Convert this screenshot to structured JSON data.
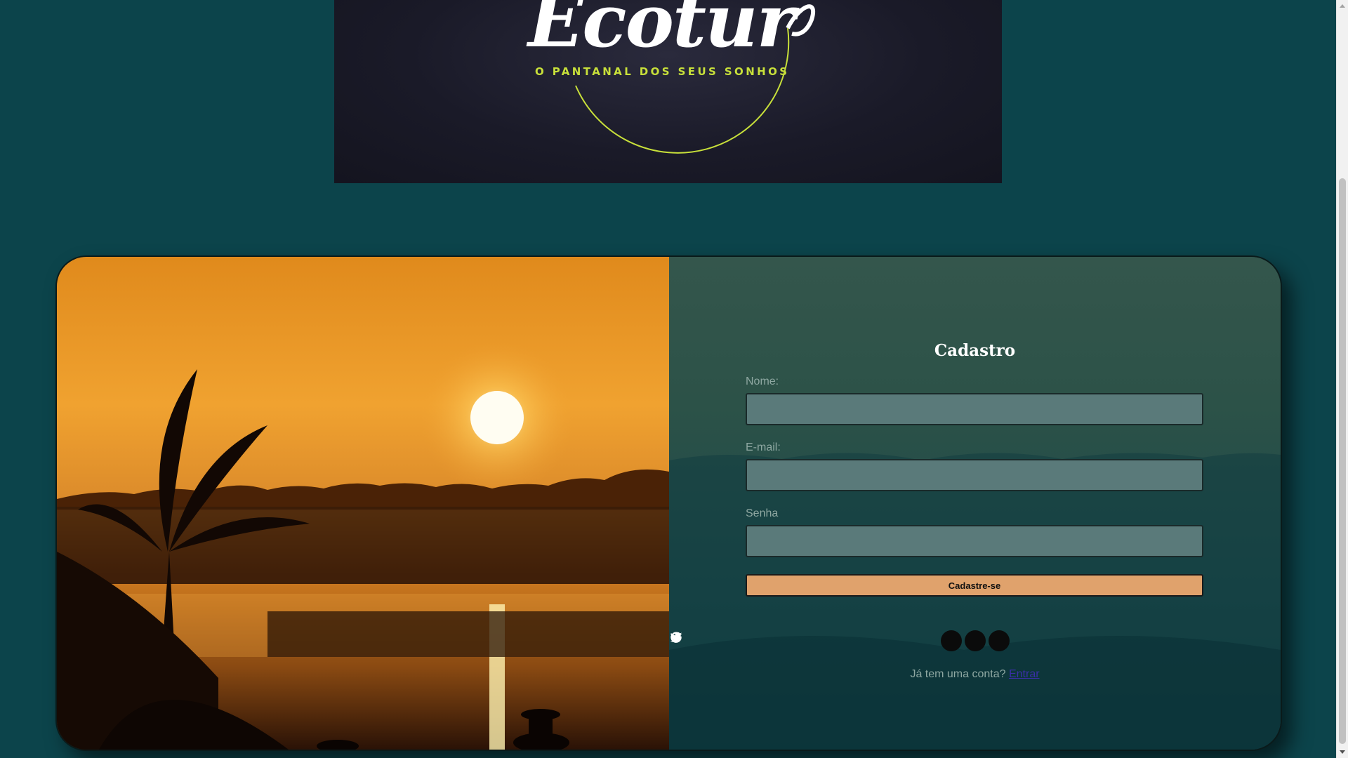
{
  "banner": {
    "brand_name": "Ecotur",
    "tagline": "O PANTANAL DOS SEUS SONHOS"
  },
  "form": {
    "title": "Cadastro",
    "fields": [
      {
        "label": "Nome:",
        "value": ""
      },
      {
        "label": "E-mail:",
        "value": ""
      },
      {
        "label": "Senha",
        "value": ""
      }
    ],
    "submit_label": "Cadastre-se",
    "social_icons": [
      "google-icon",
      "twitter-icon",
      "facebook-icon"
    ],
    "login_prompt": "Já tem uma conta?",
    "login_link": "Entrar"
  },
  "colors": {
    "page_background": "#0c444b",
    "button": "#e0a26c",
    "input": "#5a7a7a",
    "tagline": "#c8e03a"
  }
}
